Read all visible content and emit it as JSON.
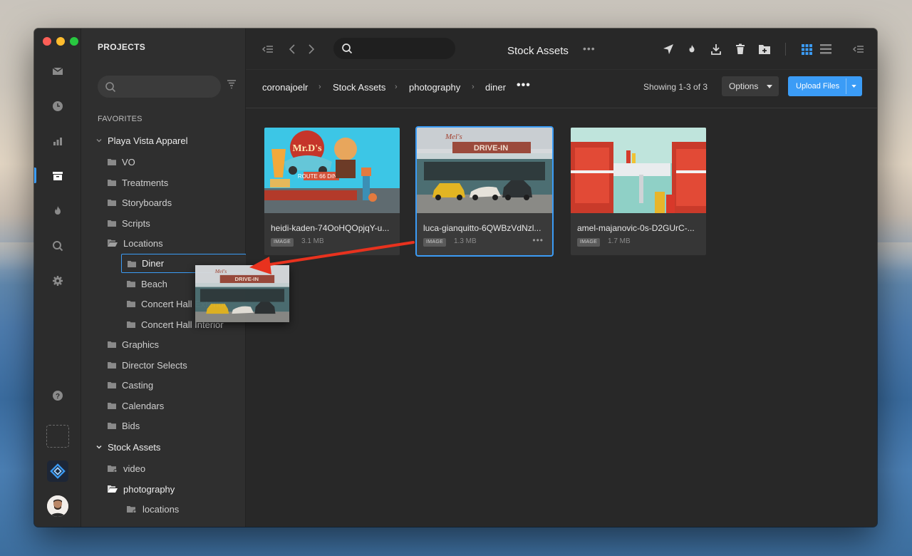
{
  "sidebar": {
    "title": "PROJECTS",
    "favorites_label": "FAVORITES",
    "tree": [
      {
        "label": "Playa Vista Apparel"
      },
      {
        "label": "VO"
      },
      {
        "label": "Treatments"
      },
      {
        "label": "Storyboards"
      },
      {
        "label": "Scripts"
      },
      {
        "label": "Locations"
      },
      {
        "label": "Diner"
      },
      {
        "label": "Beach"
      },
      {
        "label": "Concert Hall Exterior"
      },
      {
        "label": "Concert Hall Interior"
      },
      {
        "label": "Graphics"
      },
      {
        "label": "Director Selects"
      },
      {
        "label": "Casting"
      },
      {
        "label": "Calendars"
      },
      {
        "label": "Bids"
      },
      {
        "label": "Stock Assets"
      },
      {
        "label": "video"
      },
      {
        "label": "photography"
      },
      {
        "label": "locations"
      }
    ]
  },
  "header": {
    "title": "Stock Assets",
    "title_more": "•••"
  },
  "breadcrumb": {
    "items": [
      "coronajoelr",
      "Stock Assets",
      "photography",
      "diner"
    ],
    "more": "•••"
  },
  "toolbar": {
    "showing": "Showing 1-3 of 3",
    "options_label": "Options",
    "upload_label": "Upload Files"
  },
  "files": [
    {
      "name": "heidi-kaden-74OoHQOpjqY-u...",
      "type": "IMAGE",
      "size": "3.1 MB"
    },
    {
      "name": "luca-gianquitto-6QWBzVdNzl...",
      "type": "IMAGE",
      "size": "1.3 MB",
      "more": "•••"
    },
    {
      "name": "amel-majanovic-0s-D2GUrC-...",
      "type": "IMAGE",
      "size": "1.7 MB"
    }
  ],
  "colors": {
    "accent": "#3b9cf6",
    "annotation_arrow": "#e8321e",
    "window_bg": "#282828"
  }
}
